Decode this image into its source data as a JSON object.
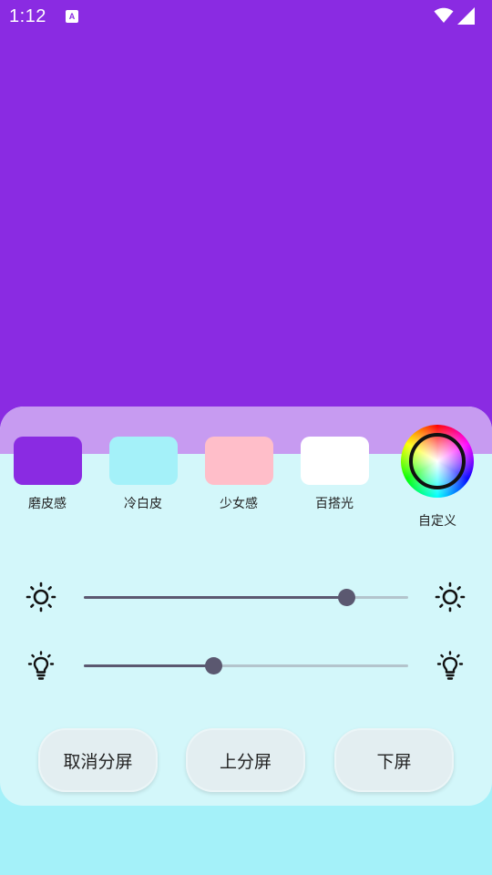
{
  "status_bar": {
    "time": "1:12",
    "app_icon_glyph": "A",
    "icons": [
      "app-notification-icon",
      "wifi-icon",
      "signal-icon"
    ]
  },
  "preview": {
    "color": "#8a2be2"
  },
  "presets": [
    {
      "label": "磨皮感",
      "color": "#8a2be2"
    },
    {
      "label": "冷白皮",
      "color": "#a4f1f9"
    },
    {
      "label": "少女感",
      "color": "#ffbec9"
    },
    {
      "label": "百搭光",
      "color": "#ffffff"
    }
  ],
  "custom": {
    "label": "自定义",
    "icon": "color-wheel-icon"
  },
  "sliders": [
    {
      "name": "brightness",
      "icon": "sun-icon",
      "value_percent": 81
    },
    {
      "name": "warmth",
      "icon": "lightbulb-icon",
      "value_percent": 40
    }
  ],
  "buttons": {
    "cancel_split": "取消分屏",
    "top_split": "上分屏",
    "bottom_split": "下屏"
  }
}
